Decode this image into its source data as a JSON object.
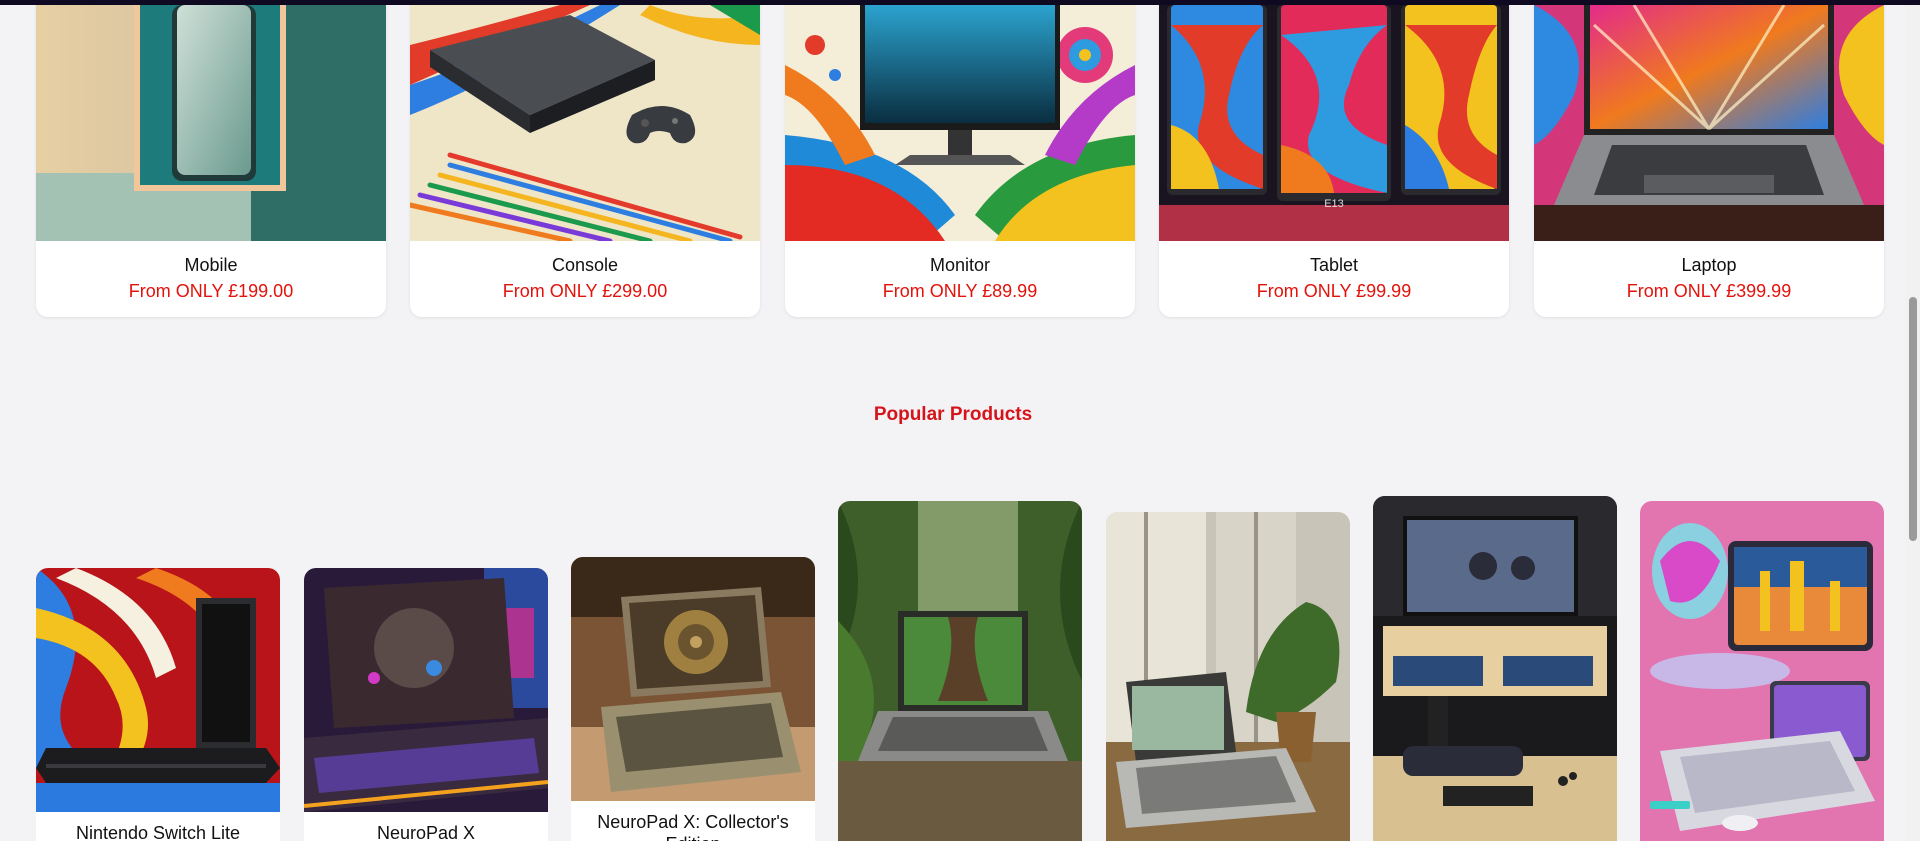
{
  "categories": [
    {
      "name": "Mobile",
      "price": "From ONLY £199.00",
      "image_icon": "mobile-phone-image"
    },
    {
      "name": "Console",
      "price": "From ONLY £299.00",
      "image_icon": "game-console-image"
    },
    {
      "name": "Monitor",
      "price": "From ONLY £89.99",
      "image_icon": "monitor-image"
    },
    {
      "name": "Tablet",
      "price": "From ONLY £99.99",
      "image_icon": "tablet-image"
    },
    {
      "name": "Laptop",
      "price": "From ONLY £399.99",
      "image_icon": "laptop-image"
    }
  ],
  "tablet_label": "E13",
  "popular": {
    "title": "Popular Products",
    "products": [
      {
        "name": "Nintendo Switch Lite"
      },
      {
        "name": "NeuroPad X"
      },
      {
        "name": "NeuroPad X: Collector's Edition"
      },
      {
        "name": ""
      },
      {
        "name": ""
      },
      {
        "name": ""
      },
      {
        "name": ""
      }
    ]
  },
  "colors": {
    "accent_red": "#e3120b",
    "section_title_red": "#d6151b",
    "page_background": "#f3f3f6"
  }
}
